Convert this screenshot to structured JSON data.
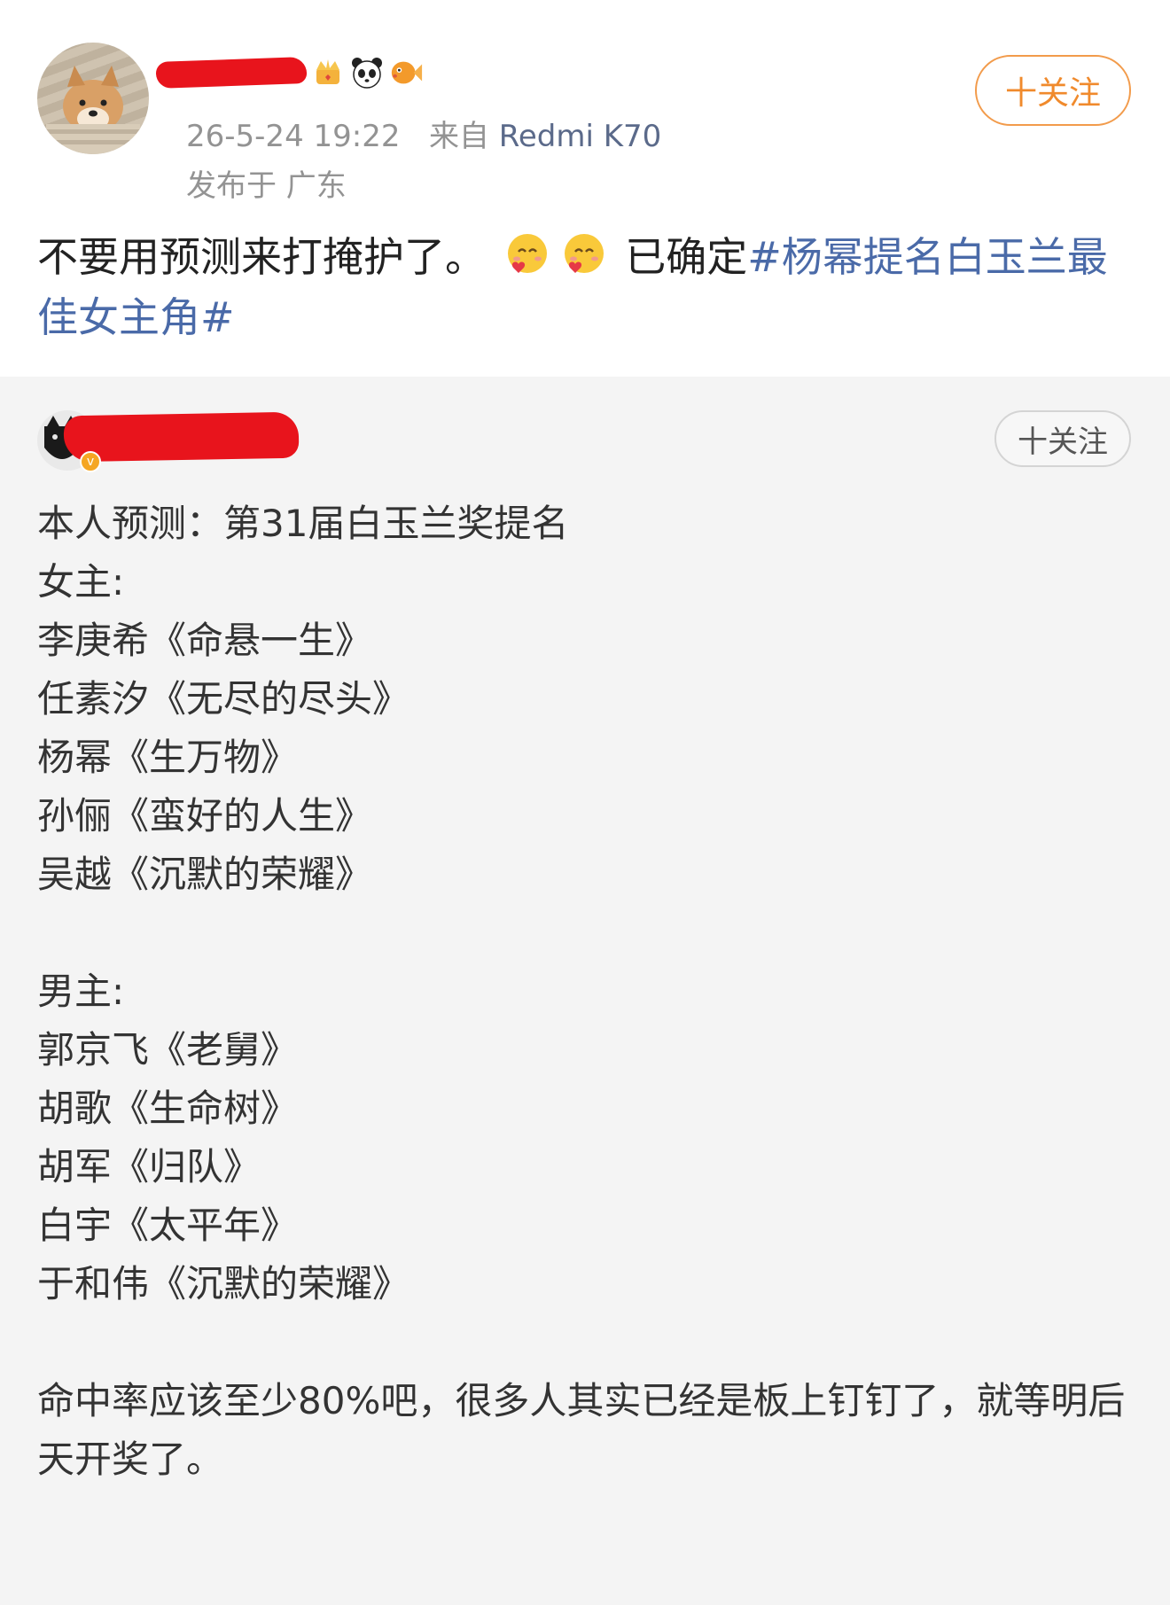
{
  "post": {
    "meta_time": "26-5-24 19:22",
    "meta_from": "来自",
    "meta_device": "Redmi K70",
    "location": "发布于 广东",
    "follow_label": "十关注",
    "text_before": "不要用预测来打掩护了。",
    "text_mid": "已确定",
    "hashtag": "#杨幂提名白玉兰最佳女主角#",
    "emojis": [
      "heart-face-emoji",
      "heart-face-emoji"
    ],
    "badges": [
      "crown-badge-icon",
      "panda-icon",
      "fish-icon"
    ]
  },
  "quote": {
    "follow_label": "十关注",
    "title": "本人预测：第31届白玉兰奖提名",
    "female_heading": "女主:",
    "female": [
      "李庚希《命悬一生》",
      "任素汐《无尽的尽头》",
      "杨幂《生万物》",
      "孙俪《蛮好的人生》",
      "吴越《沉默的荣耀》"
    ],
    "male_heading": "男主:",
    "male": [
      "郭京飞《老舅》",
      "胡歌《生命树》",
      "胡军《归队》",
      "白宇《太平年》",
      "于和伟《沉默的荣耀》"
    ],
    "closing": "命中率应该至少80%吧，很多人其实已经是板上钉钉了，就等明后天开奖了。"
  },
  "colors": {
    "hashtag": "#4a6aa8",
    "follow_orange": "#f08a2c",
    "redaction": "#e8141c",
    "meta_gray": "#939393"
  }
}
